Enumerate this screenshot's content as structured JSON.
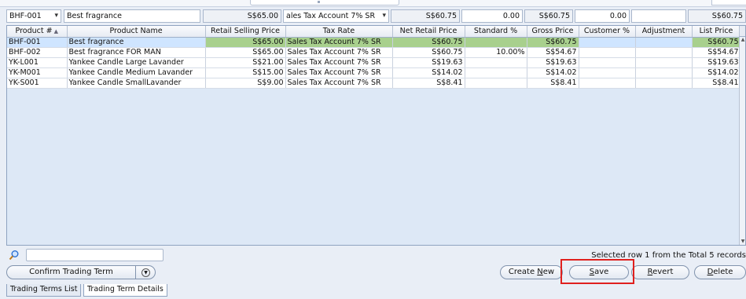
{
  "filter": {
    "product_no": "BHF-001",
    "product_name": "Best fragrance",
    "retail_price": "S$65.00",
    "tax_rate": "ales Tax Account 7% SR",
    "net_retail": "S$60.75",
    "standard_pct": "0.00",
    "gross_price": "S$60.75",
    "customer_pct": "0.00",
    "adjustment": "",
    "list_price": "S$60.75"
  },
  "grid": {
    "columns": [
      "Product #",
      "Product Name",
      "Retail Selling Price",
      "Tax Rate",
      "Net Retail Price",
      "Standard %",
      "Gross Price",
      "Customer %",
      "Adjustment",
      "List Price"
    ],
    "rows": [
      {
        "product_no": "BHF-001",
        "name": "Best fragrance",
        "retail": "S$65.00",
        "tax": "Sales Tax Account 7% SR",
        "net": "S$60.75",
        "std": "",
        "gross": "S$60.75",
        "cust": "",
        "adj": "",
        "list": "S$60.75"
      },
      {
        "product_no": "BHF-002",
        "name": "Best fragrance FOR MAN",
        "retail": "S$65.00",
        "tax": "Sales Tax Account 7% SR",
        "net": "S$60.75",
        "std": "10.00%",
        "gross": "S$54.67",
        "cust": "",
        "adj": "",
        "list": "S$54.67"
      },
      {
        "product_no": "YK-L001",
        "name": "Yankee Candle Large Lavander",
        "retail": "S$21.00",
        "tax": "Sales Tax Account 7% SR",
        "net": "S$19.63",
        "std": "",
        "gross": "S$19.63",
        "cust": "",
        "adj": "",
        "list": "S$19.63"
      },
      {
        "product_no": "YK-M001",
        "name": "Yankee Candle Medium Lavander",
        "retail": "S$15.00",
        "tax": "Sales Tax Account 7% SR",
        "net": "S$14.02",
        "std": "",
        "gross": "S$14.02",
        "cust": "",
        "adj": "",
        "list": "S$14.02"
      },
      {
        "product_no": "YK-S001",
        "name": "Yankee Candle SmallLavander",
        "retail": "S$9.00",
        "tax": "Sales Tax Account 7% SR",
        "net": "S$8.41",
        "std": "",
        "gross": "S$8.41",
        "cust": "",
        "adj": "",
        "list": "S$8.41"
      }
    ]
  },
  "search": {
    "value": ""
  },
  "status": "Selected row 1 from the Total 5 records",
  "buttons": {
    "confirm": "Confirm Trading Term",
    "create_new_pre": "Create ",
    "create_new_key": "N",
    "create_new_post": "ew",
    "save_key": "S",
    "save_post": "ave",
    "revert_key": "R",
    "revert_post": "evert",
    "delete_key": "D",
    "delete_post": "elete"
  },
  "tabs": [
    "Trading Terms List",
    "Trading Term Details"
  ],
  "colors": {
    "highlight": "#e0201e",
    "selected_row": "#cfe5ff",
    "selected_cell": "#a8d08d"
  }
}
